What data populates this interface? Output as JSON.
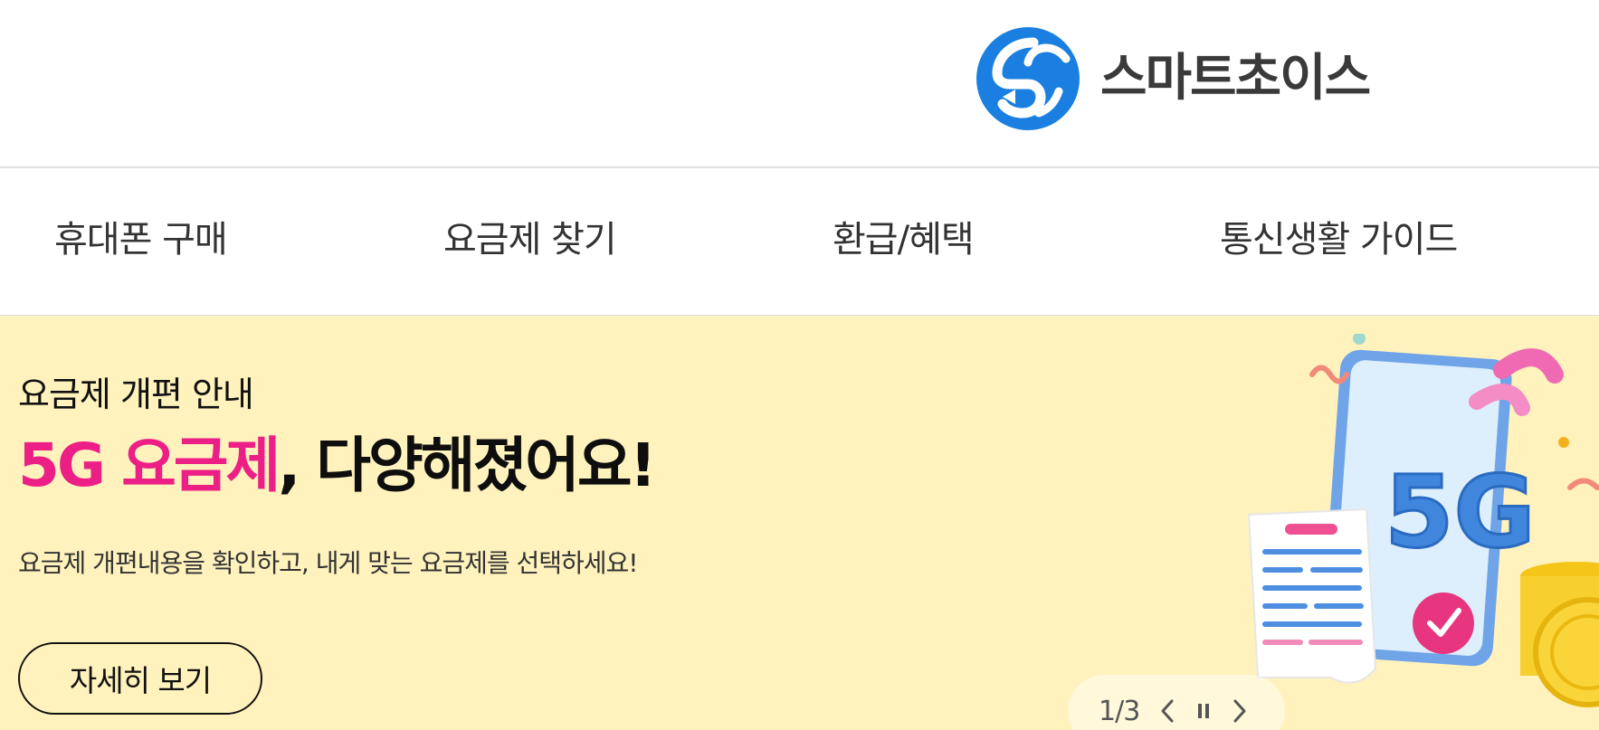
{
  "header": {
    "logo_text": "스마트초이스",
    "logo_icon": "5g-swirl-logo"
  },
  "nav": {
    "items": [
      {
        "label": "휴대폰 구매"
      },
      {
        "label": "요금제 찾기"
      },
      {
        "label": "환급/혜택"
      },
      {
        "label": "통신생활 가이드"
      }
    ]
  },
  "banner": {
    "eyebrow": "요금제 개편 안내",
    "headline_accent": "5G 요금제",
    "headline_rest": ", 다양해졌어요!",
    "description": "요금제 개편내용을 확인하고, 내게 맞는 요금제를 선택하세요!",
    "cta_label": "자세히 보기",
    "background_color": "#fff2bd",
    "accent_color": "#ec1f86",
    "illustration": {
      "icon": "5g-phone-illustration",
      "phone_text": "5G"
    }
  },
  "pager": {
    "count": "1/3",
    "prev_icon": "chevron-left-icon",
    "pause_icon": "pause-icon",
    "next_icon": "chevron-right-icon"
  },
  "colors": {
    "logo_blue": "#1a7fe0",
    "logo_text": "#3a3a3a",
    "nav_text": "#333333"
  }
}
